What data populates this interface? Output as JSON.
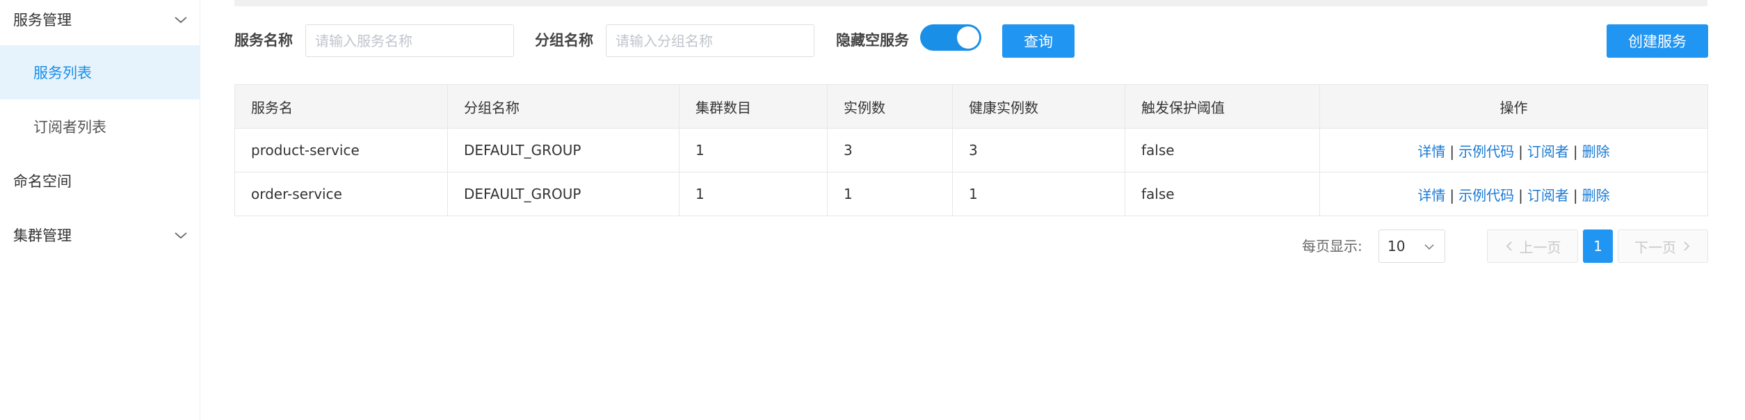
{
  "sidebar": {
    "items": [
      {
        "label": "服务管理",
        "type": "group",
        "expanded": true
      },
      {
        "label": "服务列表",
        "type": "sub",
        "active": true
      },
      {
        "label": "订阅者列表",
        "type": "sub"
      },
      {
        "label": "命名空间",
        "type": "group"
      },
      {
        "label": "集群管理",
        "type": "group",
        "expanded": false
      }
    ]
  },
  "filters": {
    "service_name_label": "服务名称",
    "service_name_placeholder": "请输入服务名称",
    "group_name_label": "分组名称",
    "group_name_placeholder": "请输入分组名称",
    "hide_empty_label": "隐藏空服务",
    "hide_empty_on": true,
    "query_button": "查询",
    "create_button": "创建服务"
  },
  "table": {
    "headers": [
      "服务名",
      "分组名称",
      "集群数目",
      "实例数",
      "健康实例数",
      "触发保护阈值",
      "操作"
    ],
    "rows": [
      {
        "service": "product-service",
        "group": "DEFAULT_GROUP",
        "clusters": "1",
        "instances": "3",
        "healthy": "3",
        "threshold": "false"
      },
      {
        "service": "order-service",
        "group": "DEFAULT_GROUP",
        "clusters": "1",
        "instances": "1",
        "healthy": "1",
        "threshold": "false"
      }
    ],
    "actions": {
      "detail": "详情",
      "sample_code": "示例代码",
      "subscribers": "订阅者",
      "delete": "删除",
      "separator": "|"
    }
  },
  "pagination": {
    "page_size_label": "每页显示:",
    "page_size": "10",
    "prev": "上一页",
    "next": "下一页",
    "current_page": "1"
  },
  "colors": {
    "primary": "#2095f2",
    "link": "#1a7ad4",
    "active_bg": "#e6f3fd"
  }
}
